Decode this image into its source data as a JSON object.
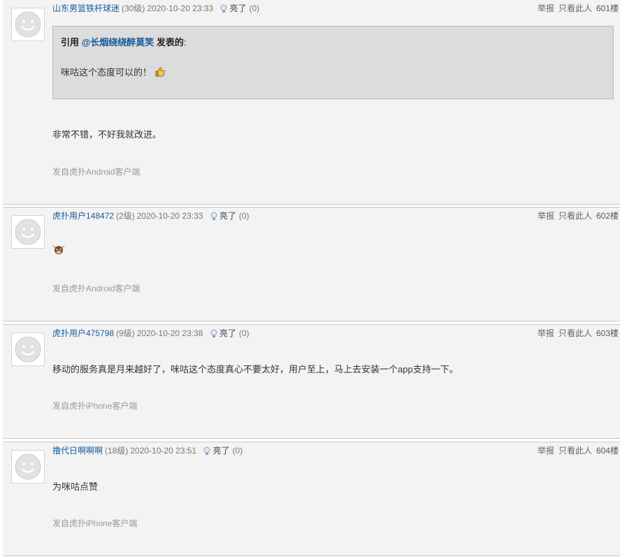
{
  "posts": [
    {
      "username": "山东男篮铁杆球迷",
      "level": "(30级)",
      "time": "2020-10-20 23:33",
      "light_label": "亮了",
      "light_count": "(0)",
      "report": "举报",
      "only_author": "只看此人",
      "floor": "601楼",
      "quote": {
        "prefix": "引用 ",
        "user": "@长烟绕绕醉莫笑",
        "suffix": " 发表的",
        "colon": ":",
        "text": "咪咕这个态度可以的！"
      },
      "content": "非常不错，不好我就改进。",
      "device": "发自虎扑Android客户端"
    },
    {
      "username": "虎扑用户148472",
      "level": "(2级)",
      "time": "2020-10-20 23:33",
      "light_label": "亮了",
      "light_count": "(0)",
      "report": "举报",
      "only_author": "只看此人",
      "floor": "602楼",
      "content_icon": "bull-emoji-icon",
      "device": "发自虎扑Android客户端"
    },
    {
      "username": "虎扑用户475798",
      "level": "(9级)",
      "time": "2020-10-20 23:38",
      "light_label": "亮了",
      "light_count": "(0)",
      "report": "举报",
      "only_author": "只看此人",
      "floor": "603楼",
      "content": "移动的服务真是月来越好了，咪咕这个态度真心不要太好，用户至上，马上去安装一个app支持一下。",
      "device": "发自虎扑iPhone客户端"
    },
    {
      "username": "撸代日啊啊啊",
      "level": "(18级)",
      "time": "2020-10-20 23:51",
      "light_label": "亮了",
      "light_count": "(0)",
      "report": "举报",
      "only_author": "只看此人",
      "floor": "604楼",
      "content": "为咪咕点赞",
      "device": "发自虎扑iPhone客户端"
    }
  ],
  "colors": {
    "link": "#155a9b",
    "post_bg": "#f3f3f3",
    "quote_bg": "#dcdcdc",
    "device_text": "#999999"
  }
}
